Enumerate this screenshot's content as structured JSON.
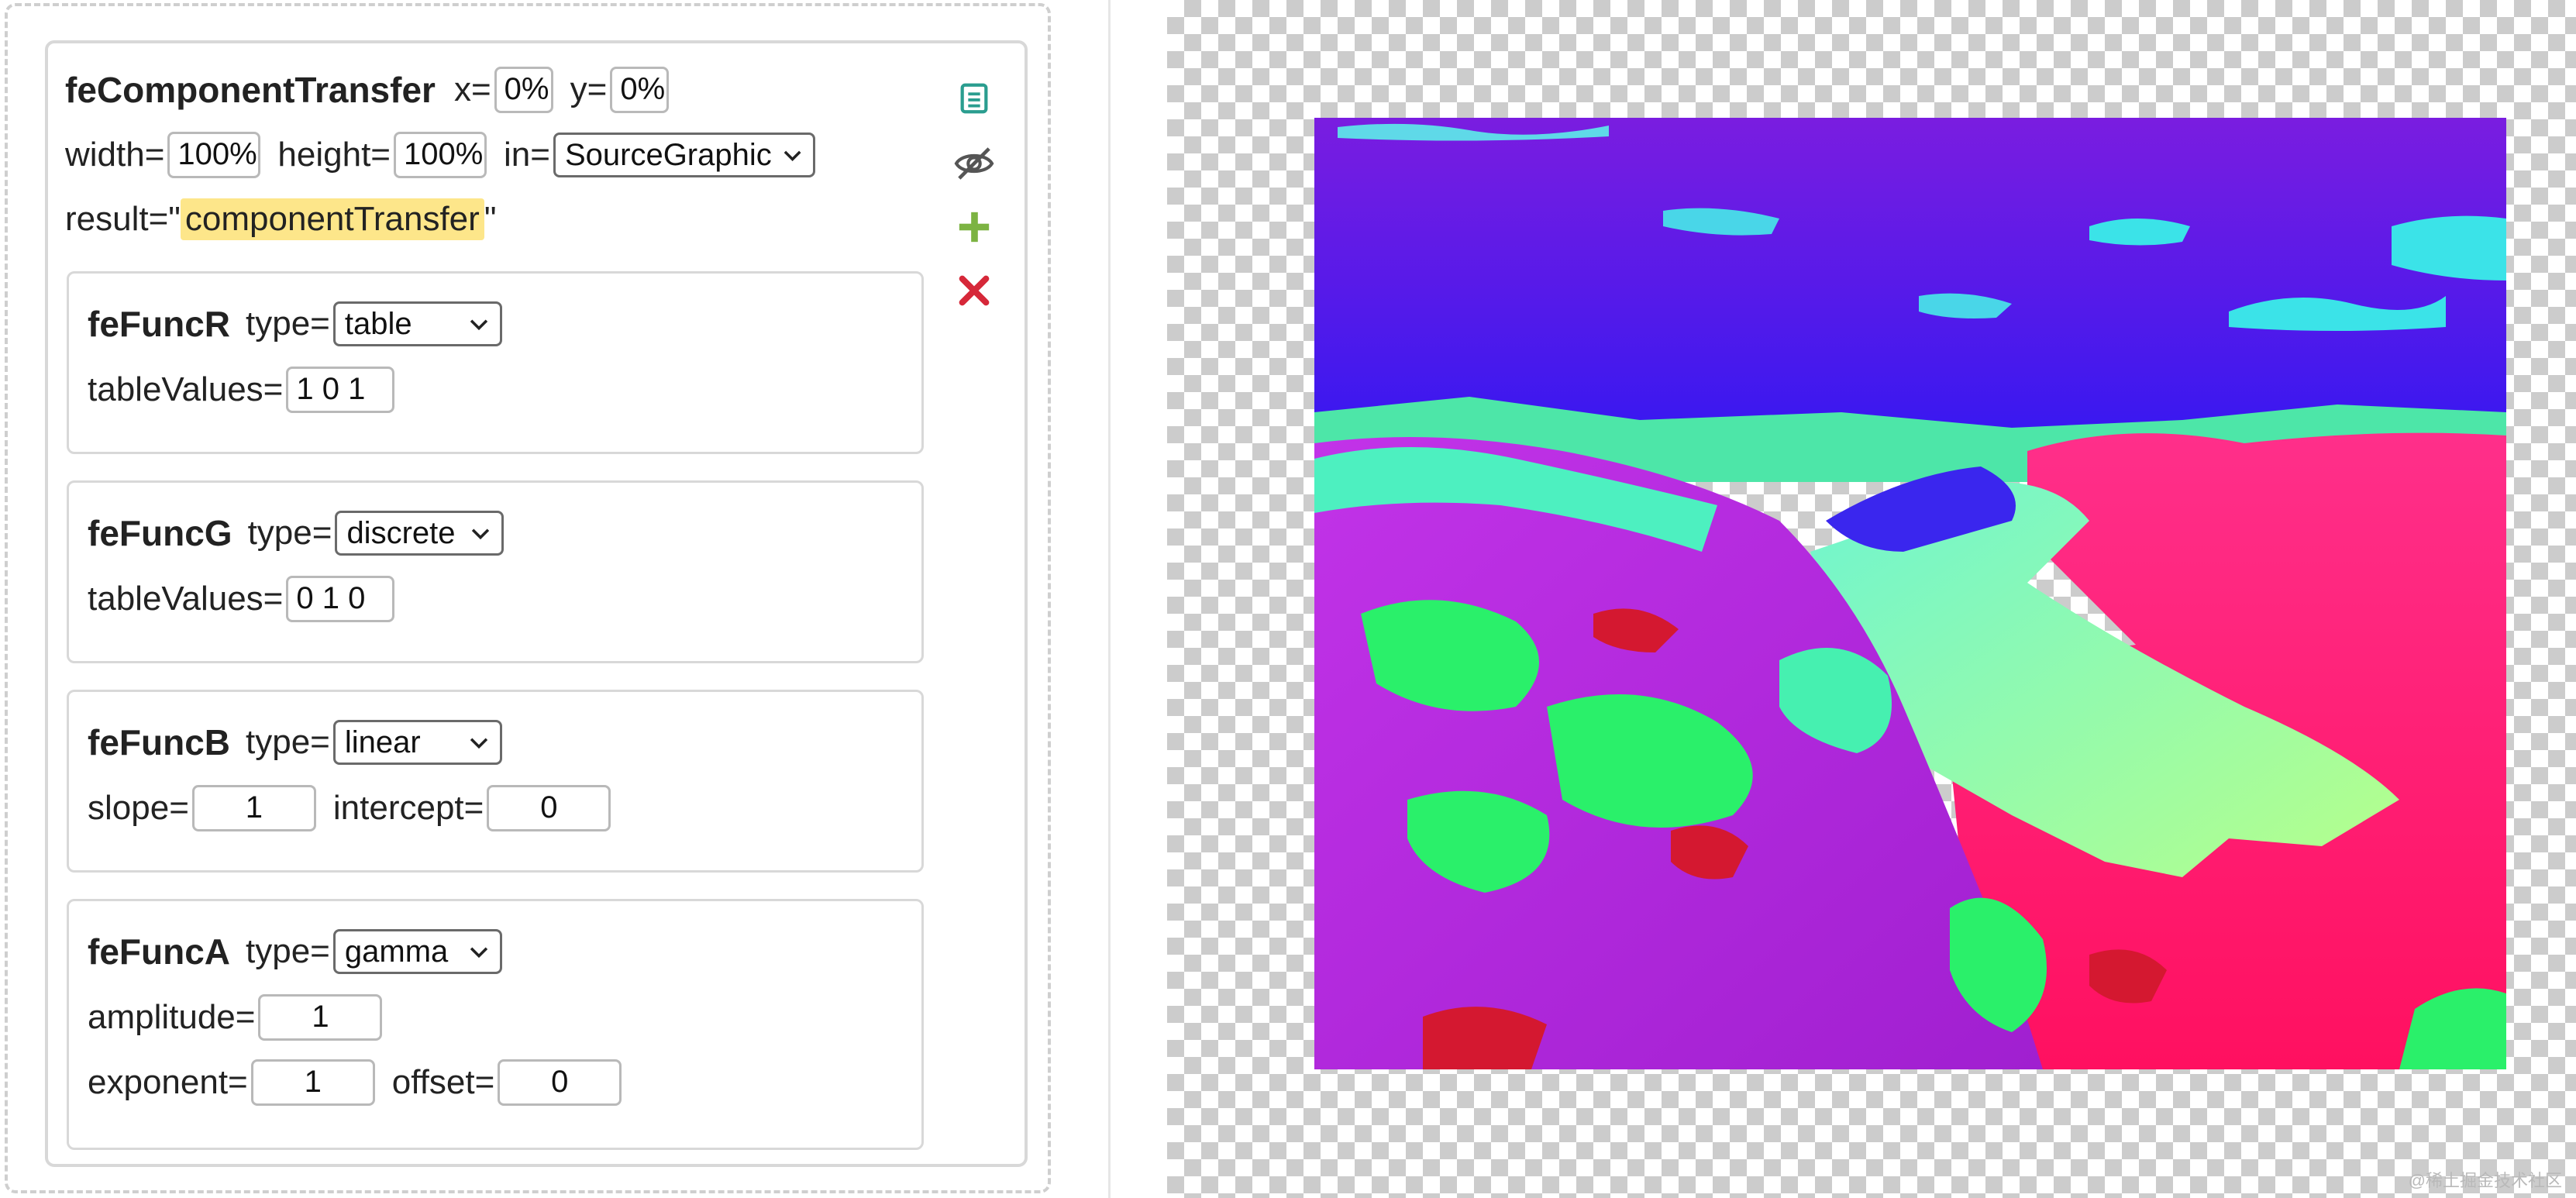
{
  "component": {
    "title": "feComponentTransfer",
    "x_label": "x=",
    "x_value": "0%",
    "y_label": "y=",
    "y_value": "0%",
    "width_label": "width=",
    "width_value": "100%",
    "height_label": "height=",
    "height_value": "100%",
    "in_label": "in=",
    "in_value": "SourceGraphic",
    "result_label_prefix": "result=\"",
    "result_value": "componentTransfer",
    "result_label_suffix": "\""
  },
  "funcs": {
    "r": {
      "title": "feFuncR",
      "type_label": "type=",
      "type_value": "table",
      "param_label": "tableValues=",
      "param_value": "1 0 1"
    },
    "g": {
      "title": "feFuncG",
      "type_label": "type=",
      "type_value": "discrete",
      "param_label": "tableValues=",
      "param_value": "0 1 0"
    },
    "b": {
      "title": "feFuncB",
      "type_label": "type=",
      "type_value": "linear",
      "slope_label": "slope=",
      "slope_value": "1",
      "intercept_label": "intercept=",
      "intercept_value": "0"
    },
    "a": {
      "title": "feFuncA",
      "type_label": "type=",
      "type_value": "gamma",
      "amplitude_label": "amplitude=",
      "amplitude_value": "1",
      "exponent_label": "exponent=",
      "exponent_value": "1",
      "offset_label": "offset=",
      "offset_value": "0"
    }
  },
  "icons": {
    "list": "list-icon",
    "visibility": "eye-off-icon",
    "add": "plus-icon",
    "remove": "close-icon"
  },
  "colors": {
    "list_icon": "#2a9d8f",
    "eye_icon": "#555555",
    "plus_icon": "#7cb342",
    "close_icon": "#d62839",
    "highlight": "#fde68a"
  },
  "watermark": "@稀土掘金技术社区"
}
